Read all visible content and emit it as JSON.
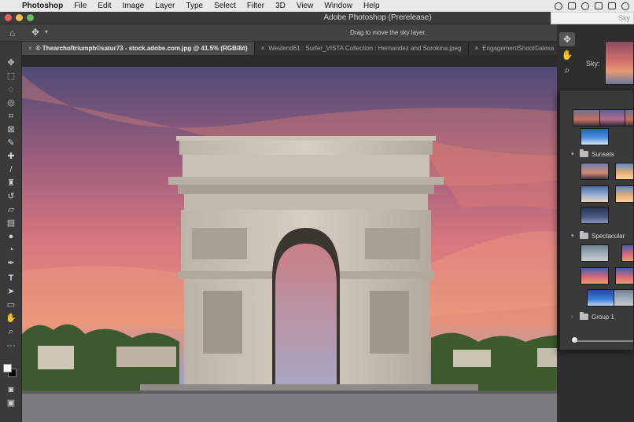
{
  "menubar": {
    "apple_icon": "apple-icon",
    "items": [
      "Photoshop",
      "File",
      "Edit",
      "Image",
      "Layer",
      "Type",
      "Select",
      "Filter",
      "3D",
      "View",
      "Window",
      "Help"
    ]
  },
  "window": {
    "title": "Adobe Photoshop (Prerelease)"
  },
  "options_bar": {
    "hint": "Drag to move the sky layer."
  },
  "tabs": [
    {
      "label": "© Thearchoftriumph©satur73 - stock.adobe.com.jpg @ 41.5% (RGB/8#)",
      "active": true
    },
    {
      "label": "Westend61 : Surfer_VISTA Collection : Hernandez and Sorokina.jpeg",
      "active": false
    },
    {
      "label": "EngagementShoot©alexa",
      "active": false
    }
  ],
  "dock": {
    "search_placeholder": "Sky",
    "sky_label": "Sky:",
    "groups": [
      {
        "name": "Sunsets"
      },
      {
        "name": "Spectacular"
      },
      {
        "name": "Group 1"
      }
    ]
  },
  "tools": [
    "move-tool-icon",
    "marquee-tool-icon",
    "lasso-tool-icon",
    "quick-select-tool-icon",
    "crop-tool-icon",
    "frame-tool-icon",
    "eyedropper-tool-icon",
    "healing-brush-icon",
    "brush-tool-icon",
    "clone-stamp-icon",
    "history-brush-icon",
    "eraser-tool-icon",
    "gradient-tool-icon",
    "blur-tool-icon",
    "dodge-tool-icon",
    "pen-tool-icon",
    "type-tool-icon",
    "path-select-icon",
    "rectangle-tool-icon",
    "hand-tool-icon",
    "zoom-tool-icon",
    "more-tools-icon"
  ],
  "colors": {
    "foreground": "#ffffff",
    "background": "#000000",
    "panel": "#3a3a3a"
  }
}
